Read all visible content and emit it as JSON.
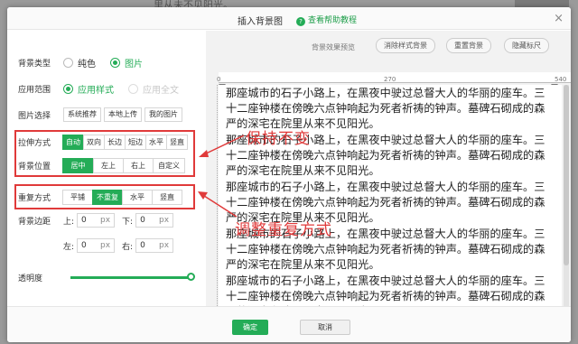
{
  "background": {
    "doc_text": "里从未不见阳光。"
  },
  "dialog": {
    "title": "插入背景图",
    "help_link": "查看帮助教程",
    "close_glyph": "×"
  },
  "settings": {
    "bg_type": {
      "label": "背景类型",
      "options": [
        "纯色",
        "图片"
      ],
      "selected": "图片"
    },
    "apply_scope": {
      "label": "应用范围",
      "options": [
        "应用样式",
        "应用全文"
      ],
      "selected": "应用样式"
    },
    "image_select": {
      "label": "图片选择",
      "buttons": [
        "系统推荐",
        "本地上传",
        "我的图片"
      ]
    },
    "stretch": {
      "label": "拉伸方式",
      "options": [
        "自动",
        "双向",
        "长边",
        "短边",
        "水平",
        "竖直"
      ],
      "selected": "自动"
    },
    "position": {
      "label": "背景位置",
      "options": [
        "居中",
        "左上",
        "右上",
        "自定义"
      ],
      "selected": "居中"
    },
    "repeat": {
      "label": "重复方式",
      "options": [
        "平铺",
        "不重复",
        "水平",
        "竖直"
      ],
      "selected": "不重复"
    },
    "margin": {
      "label": "背景边距",
      "unit": "px",
      "top": {
        "label": "上:",
        "value": "0"
      },
      "bottom": {
        "label": "下:",
        "value": "0"
      },
      "left": {
        "label": "左:",
        "value": "0"
      },
      "right": {
        "label": "右:",
        "value": "0"
      }
    },
    "opacity": {
      "label": "透明度",
      "value": 1.0
    }
  },
  "preview": {
    "label": "背景效果预览",
    "buttons": [
      "消除样式背景",
      "重置背景",
      "隐藏标尺"
    ],
    "ruler": {
      "start": "0",
      "mid": "270",
      "end": "540"
    },
    "text_line": "那座城市的石子小路上，在黑夜中驶过总督大人的华丽的座车。三十二座钟楼在傍晚六点钟响起为死者祈祷的钟声。墓碑石砌成的森严的深宅在院里从来不见阳光。"
  },
  "annotations": {
    "keep": "保持不变",
    "adjust": "调整重复方式"
  },
  "footer": {
    "ok": "确定",
    "cancel": "取消"
  },
  "colors": {
    "accent": "#24ac57",
    "annotation": "#e03a3a"
  }
}
